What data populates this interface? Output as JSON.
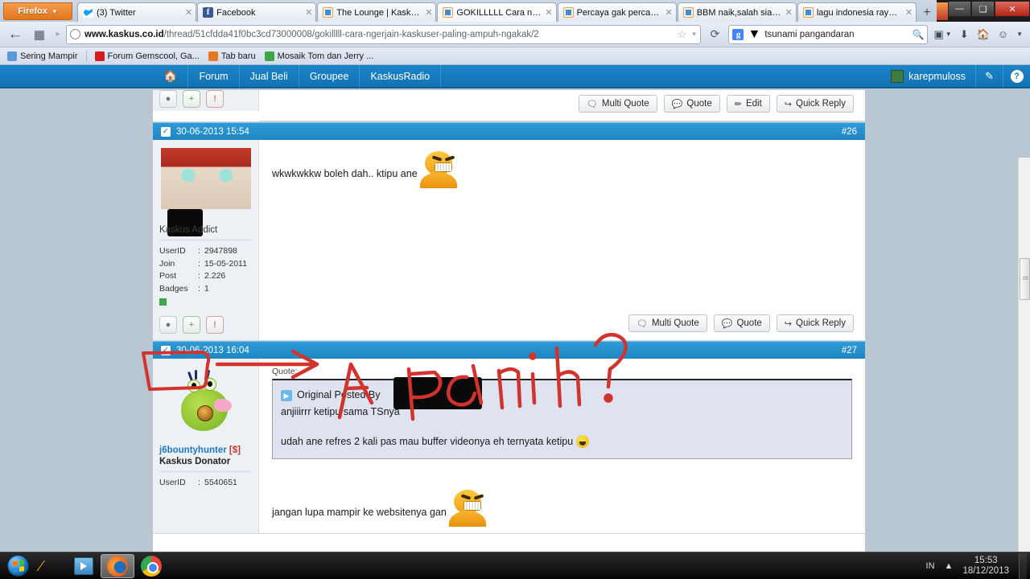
{
  "browser": {
    "app_button": "Firefox",
    "tabs": [
      {
        "label": "(3) Twitter",
        "favicon": "twitter-icon",
        "active": false
      },
      {
        "label": "Facebook",
        "favicon": "facebook-icon",
        "active": false
      },
      {
        "label": "The Lounge | Kasku...",
        "favicon": "kaskus-icon",
        "active": false
      },
      {
        "label": "GOKILLLLL Cara nge...",
        "favicon": "kaskus-icon",
        "active": true
      },
      {
        "label": "Percaya gak percaya...",
        "favicon": "kaskus-icon",
        "active": false
      },
      {
        "label": "BBM naik,salah siap...",
        "favicon": "kaskus-icon",
        "active": false
      },
      {
        "label": "lagu indonesia raya ...",
        "favicon": "kaskus-icon",
        "active": false
      }
    ],
    "new_tab_label": "+",
    "window_controls": {
      "minimize": "—",
      "maximize": "❑",
      "close": "✕"
    },
    "url_domain": "www.kaskus.co.id",
    "url_path": "/thread/51cfdda41f0bc3cd73000008/gokilllll-cara-ngerjain-kaskuser-paling-ampuh-ngakak/2",
    "search_value": "tsunami pangandaran",
    "search_engine": "g",
    "bookmarks": [
      {
        "label": "Sering Mampir",
        "color": "#5a9bd5"
      },
      {
        "label": "Forum Gemscool, Ga...",
        "color": "#d01e1e"
      },
      {
        "label": "Tab baru",
        "color": "#e87722"
      },
      {
        "label": "Mosaik Tom dan Jerry ...",
        "color": "#3fa64a"
      }
    ]
  },
  "site": {
    "nav_items": [
      "Forum",
      "Jual Beli",
      "Groupee",
      "KaskusRadio"
    ],
    "home_icon": "home-icon",
    "username": "karepmuloss",
    "edit_icon": "pencil-icon",
    "help_icon": "help-icon"
  },
  "posts": [
    {
      "timestamp": "30-06-2013 15:54",
      "number": "#26",
      "user": {
        "name": "",
        "title": "Kaskus Addict",
        "stats": [
          {
            "key": "UserID",
            "value": "2947898"
          },
          {
            "key": "Join",
            "value": "15-05-2011"
          },
          {
            "key": "Post",
            "value": "2.226"
          },
          {
            "key": "Badges",
            "value": "1"
          }
        ]
      },
      "text": "wkwkwkkw boleh dah.. ktipu ane",
      "buttons": [
        "Multi Quote",
        "Quote",
        "Quick Reply"
      ]
    },
    {
      "timestamp": "30-06-2013 16:04",
      "number": "#27",
      "user": {
        "name": "j6bountyhunter",
        "badge": "[$]",
        "title": "Kaskus Donator",
        "stats": [
          {
            "key": "UserID",
            "value": "5540651"
          }
        ]
      },
      "quote_label": "Quote:",
      "quote_header": "Original Posted By",
      "quote_line1": "anjiiirrr ketipu sama TSnya",
      "quote_line2": "udah ane refres 2 kali pas mau buffer videonya eh ternyata ketipu",
      "text": "jangan lupa mampir ke websitenya gan"
    }
  ],
  "top_post_buttons": [
    "Multi Quote",
    "Quote",
    "Edit",
    "Quick Reply"
  ],
  "annotation": {
    "handwriting": "Apa nih?",
    "color": "#d1342f"
  },
  "taskbar": {
    "start_label": "start-orb",
    "items": [
      "winamp-icon",
      "media-player-icon",
      "firefox-icon",
      "chrome-icon"
    ],
    "language": "IN",
    "time": "15:53",
    "date": "18/12/2013"
  }
}
